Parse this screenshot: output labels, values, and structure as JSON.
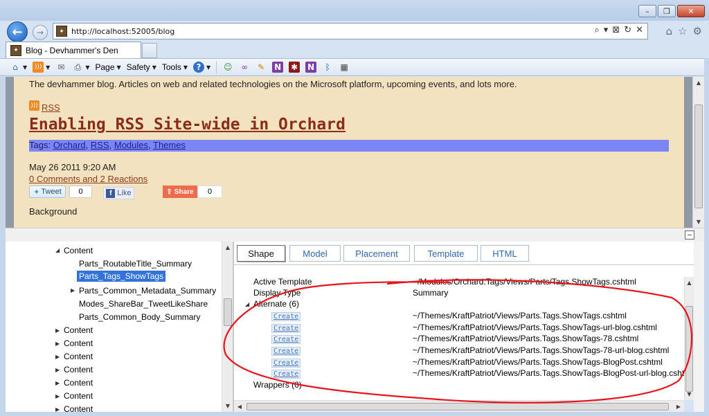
{
  "window": {
    "minimize_glyph": "–",
    "restore_glyph": "❐",
    "close_glyph": "✕"
  },
  "nav": {
    "back_glyph": "←",
    "forward_glyph": "→",
    "url_prefix": "http://",
    "url_host": "localhost",
    "url_rest": ":52005/blog",
    "address_tools": [
      "⌕",
      "▾",
      "⊠",
      "↻",
      "✕"
    ],
    "right_icons": [
      "⌂",
      "☆",
      "⚙"
    ]
  },
  "tab": {
    "title": "Blog - Devhammer's Den"
  },
  "commandbar": {
    "page_label": "Page",
    "safety_label": "Safety",
    "tools_label": "Tools",
    "help_glyph": "?"
  },
  "page": {
    "tagline": "The devhammer blog. Articles on web and related technologies on the Microsoft platform, upcoming events, and lots more.",
    "rss_label": "RSS",
    "post_title": "Enabling RSS Site-wide in Orchard",
    "tags_prefix": "Tags: ",
    "tags": [
      "Orchard",
      "RSS",
      "Modules",
      "Themes"
    ],
    "date": "May 26 2011 9:20 AM",
    "comments": "0 Comments and 2 Reactions",
    "tweet_label": "Tweet",
    "tweet_count": "0",
    "like_label": "Like",
    "share_label": "Share",
    "share_count": "0",
    "background_label": "Background"
  },
  "trace": {
    "collapse_glyph": "–",
    "tree": {
      "root": "Content",
      "children": [
        "Parts_RoutableTitle_Summary",
        "Parts_Tags_ShowTags",
        "Parts_Common_Metadata_Summary",
        "Modes_ShareBar_TweetLikeShare",
        "Parts_Common_Body_Summary"
      ],
      "siblings": [
        "Content",
        "Content",
        "Content",
        "Content",
        "Content",
        "Content",
        "Content"
      ]
    },
    "tabs": [
      "Shape",
      "Model",
      "Placement",
      "Template",
      "HTML"
    ],
    "properties": {
      "active_template_label": "Active Template",
      "active_template_value": "~/Modules/Orchard.Tags/Views/Parts/Tags.ShowTags.cshtml",
      "display_type_label": "Display Type",
      "display_type_value": "Summary",
      "alternate_label": "Alternate (6)",
      "create_label": "Create",
      "alternates": [
        "~/Themes/KraftPatriot/Views/Parts.Tags.ShowTags.cshtml",
        "~/Themes/KraftPatriot/Views/Parts.Tags.ShowTags-url-blog.cshtml",
        "~/Themes/KraftPatriot/Views/Parts.Tags.ShowTags-78.cshtml",
        "~/Themes/KraftPatriot/Views/Parts.Tags.ShowTags-78-url-blog.cshtml",
        "~/Themes/KraftPatriot/Views/Parts.Tags.ShowTags-BlogPost.cshtml",
        "~/Themes/KraftPatriot/Views/Parts.Tags.ShowTags-BlogPost-url-blog.cshtml"
      ],
      "wrappers_label": "Wrappers (0)"
    }
  },
  "colors": {
    "annotation": "#e8141b",
    "tag_bar": "#7b86f5",
    "title": "#8b2c18",
    "selection": "#3173d8"
  }
}
